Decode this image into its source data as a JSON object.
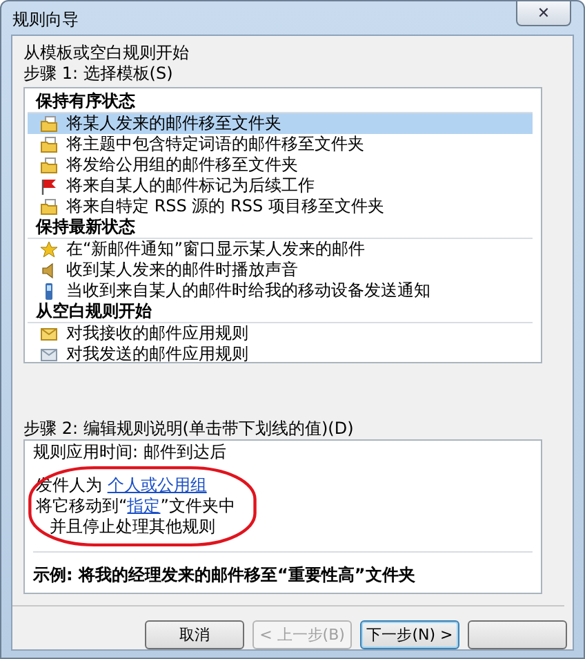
{
  "window": {
    "title": "规则向导",
    "close": "✕"
  },
  "intro": "从模板或空白规则开始",
  "step1_label": "步骤 1: 选择模板(S)",
  "template_groups": [
    {
      "title": "保持有序状态",
      "items": [
        {
          "label": "将某人发来的邮件移至文件夹",
          "kind": "folder",
          "selected": true
        },
        {
          "label": "将主题中包含特定词语的邮件移至文件夹",
          "kind": "folder",
          "selected": false
        },
        {
          "label": "将发给公用组的邮件移至文件夹",
          "kind": "folder",
          "selected": false
        },
        {
          "label": "将来自某人的邮件标记为后续工作",
          "kind": "flag",
          "selected": false
        },
        {
          "label": "将来自特定 RSS 源的 RSS 项目移至文件夹",
          "kind": "folder",
          "selected": false
        }
      ]
    },
    {
      "title": "保持最新状态",
      "items": [
        {
          "label": "在“新邮件通知”窗口显示某人发来的邮件",
          "kind": "star",
          "selected": false
        },
        {
          "label": "收到某人发来的邮件时播放声音",
          "kind": "speaker",
          "selected": false
        },
        {
          "label": "当收到来自某人的邮件时给我的移动设备发送通知",
          "kind": "phone",
          "selected": false
        }
      ]
    },
    {
      "title": "从空白规则开始",
      "items": [
        {
          "label": "对我接收的邮件应用规则",
          "kind": "inbox",
          "selected": false
        },
        {
          "label": "对我发送的邮件应用规则",
          "kind": "outbox",
          "selected": false
        }
      ]
    }
  ],
  "step2_label": "步骤 2: 编辑规则说明(单击带下划线的值)(D)",
  "description": {
    "lines": [
      {
        "kind": "plain",
        "text": "规则应用时间: 邮件到达后"
      }
    ],
    "highlighted": {
      "color": "#e0141e",
      "lines": [
        {
          "kind": "link",
          "before": "发件人为 ",
          "link": "个人或公用组"
        },
        {
          "kind": "link",
          "before": "将它移动到“",
          "link": "指定",
          "after": "”文件夹中"
        },
        {
          "kind": "indented",
          "text": "并且停止处理其他规则"
        }
      ]
    }
  },
  "example": "示例: 将我的经理发来的邮件移至“重要性高”文件夹",
  "buttons": [
    {
      "label": "取消",
      "disabled": false,
      "default": false
    },
    {
      "label": "< 上一步(B)",
      "disabled": true,
      "default": false
    },
    {
      "label": "下一步(N) >",
      "disabled": false,
      "default": true
    },
    {
      "disabled": false,
      "default": false
    }
  ]
}
